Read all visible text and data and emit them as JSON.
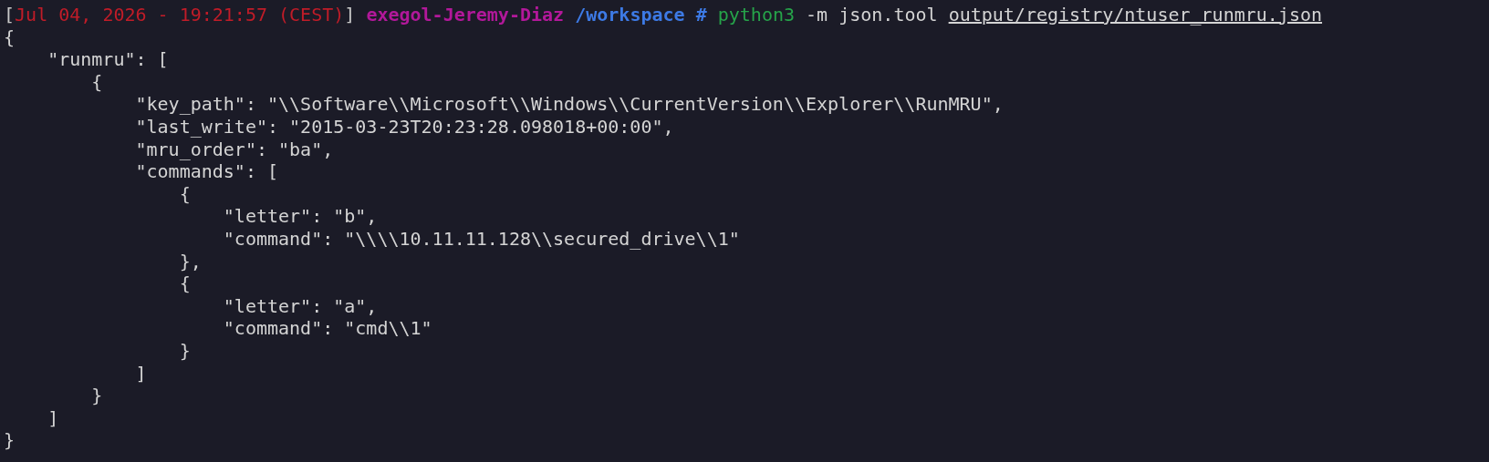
{
  "prompt": {
    "open_bracket": "[",
    "timestamp": "Jul 04, 2026 - 19:21:57 (CEST)",
    "close_bracket": "]",
    "user_host": "exegol-Jeremy-Diaz",
    "cwd": "/workspace",
    "symbol": "#",
    "program": "python3",
    "args": "-m json.tool",
    "path": "output/registry/ntuser_runmru.json"
  },
  "output_lines": [
    "{",
    "    \"runmru\": [",
    "        {",
    "            \"key_path\": \"\\\\Software\\\\Microsoft\\\\Windows\\\\CurrentVersion\\\\Explorer\\\\RunMRU\",",
    "            \"last_write\": \"2015-03-23T20:23:28.098018+00:00\",",
    "            \"mru_order\": \"ba\",",
    "            \"commands\": [",
    "                {",
    "                    \"letter\": \"b\",",
    "                    \"command\": \"\\\\\\\\10.11.11.128\\\\secured_drive\\\\1\"",
    "                },",
    "                {",
    "                    \"letter\": \"a\",",
    "                    \"command\": \"cmd\\\\1\"",
    "                }",
    "            ]",
    "        }",
    "    ]",
    "}"
  ]
}
